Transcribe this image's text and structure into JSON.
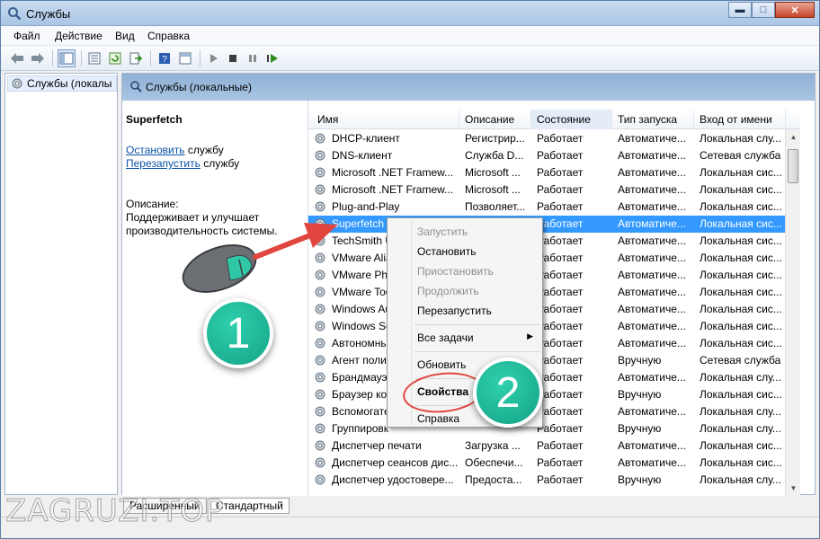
{
  "window": {
    "title": "Службы",
    "minimize_glyph": "▬",
    "maximize_glyph": "□",
    "close_glyph": "✕"
  },
  "menu": [
    "Файл",
    "Действие",
    "Вид",
    "Справка"
  ],
  "tree": {
    "item": "Службы (локалы"
  },
  "pane_header": "Службы (локальные)",
  "description": {
    "service_name": "Superfetch",
    "stop_link": "Остановить",
    "stop_suffix": " службу",
    "restart_link": "Перезапустить",
    "restart_suffix": " службу",
    "label": "Описание:",
    "text": "Поддерживает и улучшает производительность системы."
  },
  "columns": [
    "Имя",
    "Описание",
    "Состояние",
    "Тип запуска",
    "Вход от имени"
  ],
  "rows": [
    [
      "DHCP-клиент",
      "Регистрир...",
      "Работает",
      "Автоматиче...",
      "Локальная слу..."
    ],
    [
      "DNS-клиент",
      "Служба D...",
      "Работает",
      "Автоматиче...",
      "Сетевая служба"
    ],
    [
      "Microsoft .NET Framew...",
      "Microsoft ...",
      "Работает",
      "Автоматиче...",
      "Локальная сис..."
    ],
    [
      "Microsoft .NET Framew...",
      "Microsoft ...",
      "Работает",
      "Автоматиче...",
      "Локальная сис..."
    ],
    [
      "Plug-and-Play",
      "Позволяет...",
      "Работает",
      "Автоматиче...",
      "Локальная сис..."
    ],
    [
      "Superfetch",
      "",
      "Работает",
      "Автоматиче...",
      "Локальная сис..."
    ],
    [
      "TechSmith U",
      "",
      "Работает",
      "Автоматиче...",
      "Локальная сис..."
    ],
    [
      "VMware Alia",
      "",
      "Работает",
      "Автоматиче...",
      "Локальная сис..."
    ],
    [
      "VMware Phy",
      "",
      "Работает",
      "Автоматиче...",
      "Локальная сис..."
    ],
    [
      "VMware Too",
      "",
      "Работает",
      "Автоматиче...",
      "Локальная сис..."
    ],
    [
      "Windows Au",
      "",
      "Работает",
      "Автоматиче...",
      "Локальная сис..."
    ],
    [
      "Windows Se",
      "",
      "Работает",
      "Автоматиче...",
      "Локальная сис..."
    ],
    [
      "Автономны",
      "",
      "Работает",
      "Автоматиче...",
      "Локальная сис..."
    ],
    [
      "Агент поли",
      "",
      "Работает",
      "Вручную",
      "Сетевая служба"
    ],
    [
      "Брандмауэр",
      "",
      "Работает",
      "Автоматиче...",
      "Локальная слу..."
    ],
    [
      "Браузер ком",
      "",
      "Работает",
      "Вручную",
      "Локальная сис..."
    ],
    [
      "Вспомогате",
      "",
      "Работает",
      "Автоматиче...",
      "Локальная слу..."
    ],
    [
      "Группировк",
      "",
      "Работает",
      "Вручную",
      "Локальная слу..."
    ],
    [
      "Диспетчер печати",
      "Загрузка ...",
      "Работает",
      "Автоматиче...",
      "Локальная сис..."
    ],
    [
      "Диспетчер сеансов дис...",
      "Обеспечи...",
      "Работает",
      "Автоматиче...",
      "Локальная сис..."
    ],
    [
      "Диспетчер удостоверe...",
      "Предоста...",
      "Работает",
      "Вручную",
      "Локальная слу..."
    ]
  ],
  "context_menu": {
    "start": "Запустить",
    "stop": "Остановить",
    "pause": "Приостановить",
    "resume": "Продолжить",
    "restart": "Перезапустить",
    "all_tasks": "Все задачи",
    "refresh": "Обновить",
    "properties": "Свойства",
    "help": "Справка"
  },
  "tabs": [
    "Расширенный",
    "Стандартный"
  ],
  "annotations": {
    "step1": "1",
    "step2": "2"
  },
  "watermark": "ZAGRUZI.TOP",
  "colors": {
    "selection": "#3399ff",
    "badge": "#1fb896",
    "arrow": "#e0463d"
  }
}
